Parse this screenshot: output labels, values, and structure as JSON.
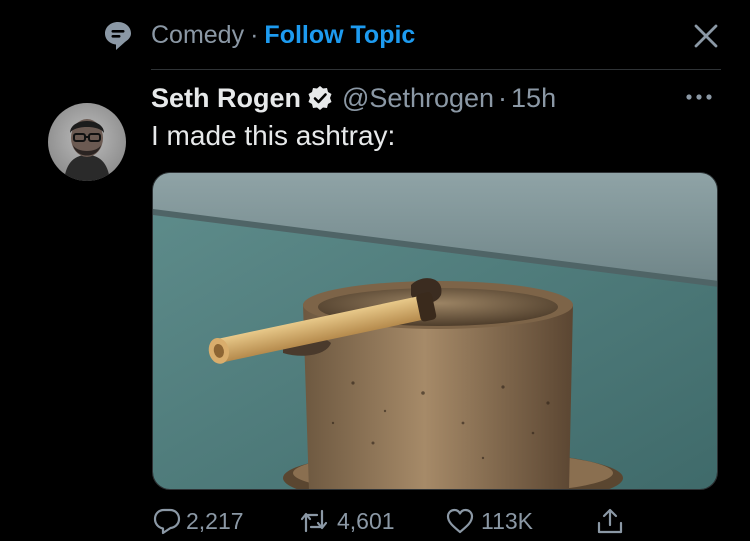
{
  "topic": {
    "icon": "topic-speech-icon",
    "name": "Comedy",
    "separator": "·",
    "follow_label": "Follow Topic",
    "close_icon": "close-icon"
  },
  "tweet": {
    "author_name": "Seth Rogen",
    "verified_icon": "verified-badge-icon",
    "handle": "@Sethrogen",
    "separator": "·",
    "time": "15h",
    "more_icon": "more-horizontal-icon",
    "text": "I made this ashtray:",
    "media_description_icon": "photo"
  },
  "actions": {
    "reply": {
      "icon": "reply-icon",
      "count": "2,217"
    },
    "retweet": {
      "icon": "retweet-icon",
      "count": "4,601"
    },
    "like": {
      "icon": "heart-icon",
      "count": "113K"
    },
    "share": {
      "icon": "share-icon"
    }
  },
  "colors": {
    "background": "#000000",
    "accent": "#1d9bf0",
    "secondary_text": "#8b98a5",
    "primary_text": "#e7e9ea"
  }
}
